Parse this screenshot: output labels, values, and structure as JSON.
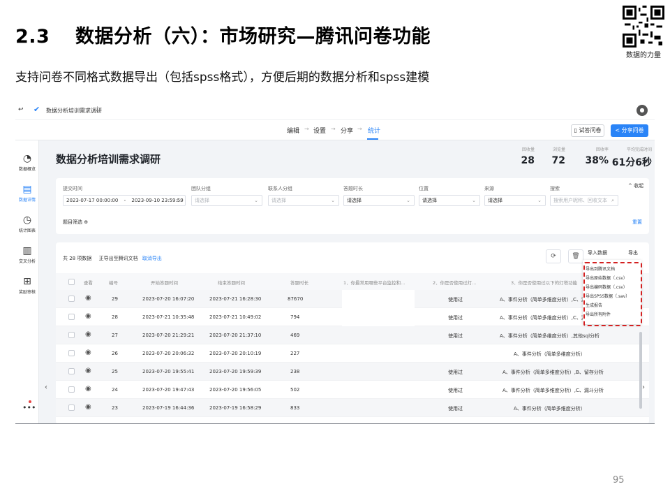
{
  "slide": {
    "title_num": "2.3",
    "title_text": "数据分析（六）：市场研究—腾讯问卷功能",
    "subtitle": "支持问卷不同格式数据导出（包括spss格式），方便后期的数据分析和spss建模",
    "qr_caption": "数据的力量",
    "page_number": "95"
  },
  "app": {
    "back_icon": "↩",
    "doc_title": "数据分析培训需求调研",
    "more": "⋮",
    "steps": [
      "编辑",
      "设置",
      "分享",
      "统计"
    ],
    "active_step": "统计",
    "preview_label": "试答问卷",
    "share_label": "分享问卷",
    "accent": "#2a84f7"
  },
  "sidebar": {
    "items": [
      {
        "label": "数据概览",
        "icon": "gauge-icon"
      },
      {
        "label": "数据详情",
        "icon": "document-icon"
      },
      {
        "label": "统计图表",
        "icon": "pie-icon"
      },
      {
        "label": "交叉分析",
        "icon": "bar-chart-icon"
      },
      {
        "label": "奖励审核",
        "icon": "gift-icon"
      }
    ],
    "more": "•••"
  },
  "survey": {
    "title": "数据分析培训需求调研",
    "stats": [
      {
        "label": "回收量",
        "value": "28"
      },
      {
        "label": "浏览量",
        "value": "72"
      },
      {
        "label": "回收率",
        "value": "38%"
      },
      {
        "label": "平均完成时间",
        "value": "61分6秒"
      }
    ]
  },
  "filters": {
    "submit_time_label": "提交时间",
    "date_start": "2023-07-17 00:00:00",
    "date_sep": "-",
    "date_end": "2023-09-10 23:59:59",
    "fields": [
      {
        "label": "团队分组",
        "placeholder": "请选择"
      },
      {
        "label": "联系人分组",
        "placeholder": "请选择"
      },
      {
        "label": "答题时长",
        "value": "请选择"
      },
      {
        "label": "位置",
        "value": "请选择"
      },
      {
        "label": "来源",
        "value": "请选择"
      }
    ],
    "search_label": "搜索",
    "search_placeholder": "搜索用户昵称、回收文本",
    "collapse": "收起",
    "question_filter": "题目筛选",
    "reset": "重置"
  },
  "table": {
    "info": "共 28 项数据",
    "exporting": "正导出至腾讯文档",
    "cancel_export": "取消导出",
    "import_label": "导入数据",
    "export_label": "导出",
    "headers": [
      "查看",
      "编号",
      "开始答题时间",
      "结束答题时间",
      "答题时长",
      "1．你最常用哪些平台监控和...",
      "2．你是否使用过灯...",
      "3．你是否使用过以下的灯塔功能"
    ],
    "rows": [
      {
        "id": "29",
        "start": "2023-07-20 16:07:20",
        "end": "2023-07-21 16:28:30",
        "duration": "87670",
        "q2": "使用过",
        "q3": "A、事件分析（简单多维度分析）,C、漏斗分"
      },
      {
        "id": "28",
        "start": "2023-07-21 10:35:48",
        "end": "2023-07-21 10:49:02",
        "duration": "794",
        "q2": "使用过",
        "q3": "A、事件分析（简单多维度分析）,C、漏斗分"
      },
      {
        "id": "27",
        "start": "2023-07-20 21:29:21",
        "end": "2023-07-20 21:37:10",
        "duration": "469",
        "q2": "使用过",
        "q3": "A、事件分析（简单多维度分析）,其他sql分析"
      },
      {
        "id": "26",
        "start": "2023-07-20 20:06:32",
        "end": "2023-07-20 20:10:19",
        "duration": "227",
        "q2": "",
        "q3": "A、事件分析（简单多维度分析）"
      },
      {
        "id": "25",
        "start": "2023-07-20 19:55:41",
        "end": "2023-07-20 19:59:39",
        "duration": "238",
        "q2": "使用过",
        "q3": "A、事件分析（简单多维度分析）,B、留存分析"
      },
      {
        "id": "24",
        "start": "2023-07-20 19:47:43",
        "end": "2023-07-20 19:56:05",
        "duration": "502",
        "q2": "使用过",
        "q3": "A、事件分析（简单多维度分析）,C、漏斗分析"
      },
      {
        "id": "23",
        "start": "2023-07-19 16:44:36",
        "end": "2023-07-19 16:58:29",
        "duration": "833",
        "q2": "使用过",
        "q3": "A、事件分析（简单多维度分析）"
      }
    ]
  },
  "export_menu": {
    "items": [
      "导出到腾讯文档",
      "导出原始数据（.csv）",
      "导出编码数据（.csv）",
      "导出SPSS数据（.sav）",
      "生成报告",
      "导出所有附件"
    ],
    "highlight_color": "#d32020"
  }
}
